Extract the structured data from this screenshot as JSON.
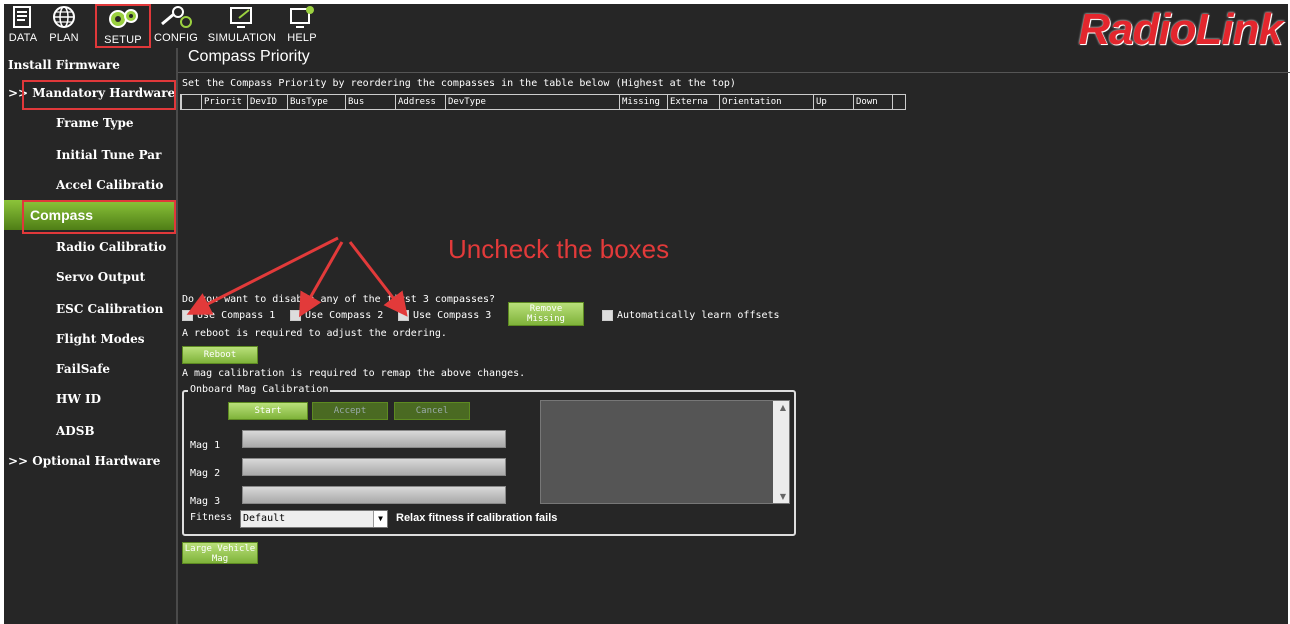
{
  "toolbar": {
    "items": [
      {
        "label": "DATA",
        "icon": "data-icon"
      },
      {
        "label": "PLAN",
        "icon": "globe-icon"
      },
      {
        "label": "SETUP",
        "icon": "gear-icon"
      },
      {
        "label": "CONFIG",
        "icon": "wrench-icon"
      },
      {
        "label": "SIMULATION",
        "icon": "simulation-icon"
      },
      {
        "label": "HELP",
        "icon": "help-icon"
      }
    ],
    "logo": "RadioLink"
  },
  "sidebar": {
    "install_firmware": "Install Firmware",
    "mandatory_hardware": ">> Mandatory Hardware",
    "items": [
      "Frame Type",
      "Initial Tune Par",
      "Accel Calibratio",
      "Compass",
      "Radio Calibratio",
      "Servo Output",
      "ESC Calibration",
      "Flight Modes",
      "FailSafe",
      "HW ID",
      "ADSB"
    ],
    "optional_hardware": ">> Optional Hardware"
  },
  "content": {
    "title": "Compass Priority",
    "instruction": "Set the Compass Priority by reordering the compasses in the table below (Highest at the top)",
    "table_columns": [
      "",
      "Priorit",
      "DevID",
      "BusType",
      "Bus",
      "Address",
      "DevType",
      "Missing",
      "Externa",
      "Orientation",
      "Up",
      "Down"
    ],
    "annotation": "Uncheck the boxes",
    "disable_question": "Do you want to disable any of the first 3 compasses?",
    "use_compass_1": "Use Compass 1",
    "use_compass_2": "Use Compass 2",
    "use_compass_3": "Use Compass 3",
    "remove_missing": "Remove Missing",
    "auto_learn": "Automatically learn offsets",
    "reboot_note": "A reboot is required to adjust the ordering.",
    "reboot_button": "Reboot",
    "mag_note": "A mag calibration is required to remap the above changes.",
    "onboard": {
      "title": "Onboard Mag Calibration",
      "start": "Start",
      "accept": "Accept",
      "cancel": "Cancel",
      "mag1": "Mag 1",
      "mag2": "Mag 2",
      "mag3": "Mag 3",
      "fitness_label": "Fitness",
      "fitness_value": "Default",
      "relax": "Relax fitness if calibration fails"
    },
    "large_vehicle": "Large Vehicle Mag"
  },
  "colors": {
    "background": "#262626",
    "accent_green": "#7fb33a",
    "highlight_red": "#e0383a",
    "logo_red": "#e3262d"
  }
}
